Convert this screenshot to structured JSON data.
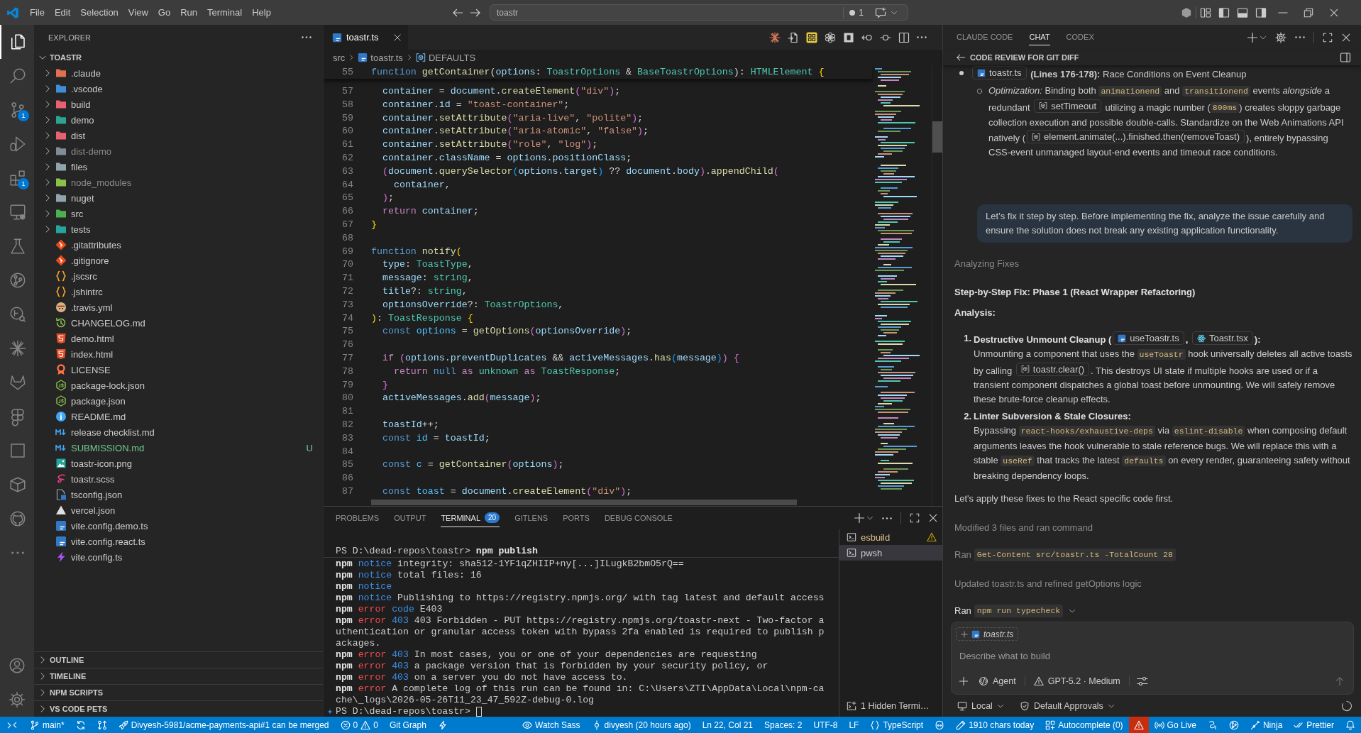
{
  "title_bar": {
    "menu": [
      "File",
      "Edit",
      "Selection",
      "View",
      "Go",
      "Run",
      "Terminal",
      "Help"
    ],
    "command_center": {
      "text": "toastr",
      "count": "1"
    }
  },
  "activity_bar": {
    "items": [
      {
        "selected": true
      },
      {
        "selected": false
      },
      {
        "selected": false,
        "badge": "1"
      },
      {
        "selected": false
      },
      {
        "selected": false,
        "badge": "1"
      },
      {
        "selected": false
      },
      {
        "selected": false
      },
      {
        "selected": false
      },
      {
        "selected": false
      },
      {
        "selected": false
      },
      {
        "selected": false
      },
      {
        "selected": false
      },
      {
        "selected": false
      },
      {
        "selected": false
      },
      {
        "selected": false
      },
      {
        "selected": false
      }
    ]
  },
  "explorer": {
    "title": "EXPLORER",
    "root": {
      "name": "TOASTR",
      "expanded": true,
      "children": [
        {
          "name": ".claude",
          "kind": "folder",
          "expanded": false,
          "color": "#e07050",
          "ignored": false
        },
        {
          "name": ".vscode",
          "kind": "folder",
          "expanded": false,
          "color": "#3d8fd8",
          "ignored": false
        },
        {
          "name": "build",
          "kind": "folder",
          "expanded": false,
          "color": "#e86170",
          "ignored": false
        },
        {
          "name": "demo",
          "kind": "folder",
          "expanded": false,
          "color": "#2aa58f",
          "ignored": false
        },
        {
          "name": "dist",
          "kind": "folder",
          "expanded": false,
          "color": "#e86170",
          "ignored": false
        },
        {
          "name": "dist-demo",
          "kind": "folder",
          "expanded": false,
          "color": "#7f8c99",
          "ignored": true
        },
        {
          "name": "files",
          "kind": "folder",
          "expanded": false,
          "color": "#90a4ae",
          "ignored": false
        },
        {
          "name": "node_modules",
          "kind": "folder",
          "expanded": false,
          "color": "#8bc34a",
          "ignored": true
        },
        {
          "name": "nuget",
          "kind": "folder",
          "expanded": false,
          "color": "#90a4ae",
          "ignored": false
        },
        {
          "name": "src",
          "kind": "folder",
          "expanded": false,
          "color": "#4caf50",
          "ignored": false
        },
        {
          "name": "tests",
          "kind": "folder",
          "expanded": false,
          "color": "#26a69a",
          "ignored": false
        },
        {
          "name": ".gitattributes",
          "kind": "git",
          "ignored": false
        },
        {
          "name": ".gitignore",
          "kind": "git",
          "ignored": false
        },
        {
          "name": ".jscsrc",
          "kind": "rc",
          "ignored": false
        },
        {
          "name": ".jshintrc",
          "kind": "rc",
          "ignored": false
        },
        {
          "name": ".travis.yml",
          "kind": "travis",
          "ignored": false
        },
        {
          "name": "CHANGELOG.md",
          "kind": "changelog",
          "ignored": false
        },
        {
          "name": "demo.html",
          "kind": "html",
          "ignored": false
        },
        {
          "name": "index.html",
          "kind": "html",
          "ignored": false
        },
        {
          "name": "LICENSE",
          "kind": "license",
          "ignored": false
        },
        {
          "name": "package-lock.json",
          "kind": "npm",
          "ignored": false
        },
        {
          "name": "package.json",
          "kind": "npm",
          "ignored": false
        },
        {
          "name": "README.md",
          "kind": "readme",
          "ignored": false
        },
        {
          "name": "release checklist.md",
          "kind": "markdown",
          "ignored": false
        },
        {
          "name": "SUBMISSION.md",
          "kind": "markdown",
          "ignored": false,
          "status": "U"
        },
        {
          "name": "toastr-icon.png",
          "kind": "image",
          "ignored": false
        },
        {
          "name": "toastr.scss",
          "kind": "sass",
          "ignored": false
        },
        {
          "name": "tsconfig.json",
          "kind": "tsconfig",
          "ignored": false
        },
        {
          "name": "vercel.json",
          "kind": "vercel",
          "ignored": false
        },
        {
          "name": "vite.config.demo.ts",
          "kind": "typescript",
          "ignored": false
        },
        {
          "name": "vite.config.react.ts",
          "kind": "typescript",
          "ignored": false
        },
        {
          "name": "vite.config.ts",
          "kind": "vite",
          "ignored": false
        }
      ]
    },
    "sections": [
      {
        "title": "OUTLINE",
        "expanded": false
      },
      {
        "title": "TIMELINE",
        "expanded": false
      },
      {
        "title": "NPM SCRIPTS",
        "expanded": false
      },
      {
        "title": "VS CODE PETS",
        "expanded": false
      }
    ]
  },
  "editor": {
    "tabs": [
      {
        "label": "toastr.ts",
        "selected": true
      }
    ],
    "breadcrumbs": [
      {
        "kind": "folder",
        "text": "src"
      },
      {
        "kind": "file",
        "text": "toastr.ts"
      },
      {
        "kind": "symbol",
        "text": "DEFAULTS"
      }
    ],
    "sticky_line": {
      "number": "55",
      "tokens": [
        {
          "kind": "kw",
          "text": "function "
        },
        {
          "kind": "fn",
          "text": "getContainer"
        },
        {
          "kind": "p",
          "text": "("
        },
        {
          "kind": "var",
          "text": "options"
        },
        {
          "kind": "p",
          "text": ": "
        },
        {
          "kind": "type",
          "text": "ToastrOptions"
        },
        {
          "kind": "p",
          "text": " & "
        },
        {
          "kind": "type",
          "text": "BaseToastrOptions"
        },
        {
          "kind": "p",
          "text": "): "
        },
        {
          "kind": "type",
          "text": "HTMLElement "
        },
        {
          "kind": "b1",
          "text": "{"
        }
      ]
    },
    "lines": [
      {
        "number": "57",
        "tokens": [
          {
            "kind": "var",
            "text": "  container"
          },
          {
            "kind": "p",
            "text": " = "
          },
          {
            "kind": "var",
            "text": "document"
          },
          {
            "kind": "p",
            "text": "."
          },
          {
            "kind": "fn",
            "text": "createElement"
          },
          {
            "kind": "b2",
            "text": "("
          },
          {
            "kind": "str",
            "text": "\"div\""
          },
          {
            "kind": "b2",
            "text": ")"
          },
          {
            "kind": "p",
            "text": ";"
          }
        ]
      },
      {
        "number": "58",
        "tokens": [
          {
            "kind": "var",
            "text": "  container"
          },
          {
            "kind": "p",
            "text": "."
          },
          {
            "kind": "var",
            "text": "id"
          },
          {
            "kind": "p",
            "text": " = "
          },
          {
            "kind": "str",
            "text": "\"toast-container\""
          },
          {
            "kind": "p",
            "text": ";"
          }
        ]
      },
      {
        "number": "59",
        "tokens": [
          {
            "kind": "var",
            "text": "  container"
          },
          {
            "kind": "p",
            "text": "."
          },
          {
            "kind": "fn",
            "text": "setAttribute"
          },
          {
            "kind": "b2",
            "text": "("
          },
          {
            "kind": "str",
            "text": "\"aria-live\""
          },
          {
            "kind": "p",
            "text": ", "
          },
          {
            "kind": "str",
            "text": "\"polite\""
          },
          {
            "kind": "b2",
            "text": ")"
          },
          {
            "kind": "p",
            "text": ";"
          }
        ]
      },
      {
        "number": "60",
        "tokens": [
          {
            "kind": "var",
            "text": "  container"
          },
          {
            "kind": "p",
            "text": "."
          },
          {
            "kind": "fn",
            "text": "setAttribute"
          },
          {
            "kind": "b2",
            "text": "("
          },
          {
            "kind": "str",
            "text": "\"aria-atomic\""
          },
          {
            "kind": "p",
            "text": ", "
          },
          {
            "kind": "str",
            "text": "\"false\""
          },
          {
            "kind": "b2",
            "text": ")"
          },
          {
            "kind": "p",
            "text": ";"
          }
        ]
      },
      {
        "number": "61",
        "tokens": [
          {
            "kind": "var",
            "text": "  container"
          },
          {
            "kind": "p",
            "text": "."
          },
          {
            "kind": "fn",
            "text": "setAttribute"
          },
          {
            "kind": "b2",
            "text": "("
          },
          {
            "kind": "str",
            "text": "\"role\""
          },
          {
            "kind": "p",
            "text": ", "
          },
          {
            "kind": "str",
            "text": "\"log\""
          },
          {
            "kind": "b2",
            "text": ")"
          },
          {
            "kind": "p",
            "text": ";"
          }
        ]
      },
      {
        "number": "62",
        "tokens": [
          {
            "kind": "var",
            "text": "  container"
          },
          {
            "kind": "p",
            "text": "."
          },
          {
            "kind": "var",
            "text": "className"
          },
          {
            "kind": "p",
            "text": " = "
          },
          {
            "kind": "var",
            "text": "options"
          },
          {
            "kind": "p",
            "text": "."
          },
          {
            "kind": "var",
            "text": "positionClass"
          },
          {
            "kind": "p",
            "text": ";"
          }
        ]
      },
      {
        "number": "63",
        "tokens": [
          {
            "kind": "b2",
            "text": "  ("
          },
          {
            "kind": "var",
            "text": "document"
          },
          {
            "kind": "p",
            "text": "."
          },
          {
            "kind": "fn",
            "text": "querySelector"
          },
          {
            "kind": "b3",
            "text": "("
          },
          {
            "kind": "var",
            "text": "options"
          },
          {
            "kind": "p",
            "text": "."
          },
          {
            "kind": "var",
            "text": "target"
          },
          {
            "kind": "b3",
            "text": ")"
          },
          {
            "kind": "p",
            "text": " ?? "
          },
          {
            "kind": "var",
            "text": "document"
          },
          {
            "kind": "p",
            "text": "."
          },
          {
            "kind": "var",
            "text": "body"
          },
          {
            "kind": "b2",
            "text": ")"
          },
          {
            "kind": "p",
            "text": "."
          },
          {
            "kind": "fn",
            "text": "appendChild"
          },
          {
            "kind": "b2",
            "text": "("
          }
        ]
      },
      {
        "number": "64",
        "tokens": [
          {
            "kind": "var",
            "text": "    container"
          },
          {
            "kind": "p",
            "text": ","
          }
        ]
      },
      {
        "number": "65",
        "tokens": [
          {
            "kind": "b2",
            "text": "  )"
          },
          {
            "kind": "p",
            "text": ";"
          }
        ]
      },
      {
        "number": "66",
        "tokens": [
          {
            "kind": "ctl",
            "text": "  return "
          },
          {
            "kind": "var",
            "text": "container"
          },
          {
            "kind": "p",
            "text": ";"
          }
        ]
      },
      {
        "number": "67",
        "tokens": [
          {
            "kind": "b1",
            "text": "}"
          }
        ]
      },
      {
        "number": "68"
      },
      {
        "number": "69",
        "tokens": [
          {
            "kind": "kw",
            "text": "function "
          },
          {
            "kind": "fn",
            "text": "notify"
          },
          {
            "kind": "b1",
            "text": "("
          }
        ]
      },
      {
        "number": "70",
        "tokens": [
          {
            "kind": "var",
            "text": "  type"
          },
          {
            "kind": "p",
            "text": ": "
          },
          {
            "kind": "type",
            "text": "ToastType"
          },
          {
            "kind": "p",
            "text": ","
          }
        ]
      },
      {
        "number": "71",
        "tokens": [
          {
            "kind": "var",
            "text": "  message"
          },
          {
            "kind": "p",
            "text": ": "
          },
          {
            "kind": "type",
            "text": "string"
          },
          {
            "kind": "p",
            "text": ","
          }
        ]
      },
      {
        "number": "72",
        "tokens": [
          {
            "kind": "var",
            "text": "  title"
          },
          {
            "kind": "p",
            "text": "?: "
          },
          {
            "kind": "type",
            "text": "string"
          },
          {
            "kind": "p",
            "text": ","
          }
        ]
      },
      {
        "number": "73",
        "tokens": [
          {
            "kind": "var",
            "text": "  optionsOverride"
          },
          {
            "kind": "p",
            "text": "?: "
          },
          {
            "kind": "type",
            "text": "ToastrOptions"
          },
          {
            "kind": "p",
            "text": ","
          }
        ]
      },
      {
        "number": "74",
        "tokens": [
          {
            "kind": "b1",
            "text": ")"
          },
          {
            "kind": "p",
            "text": ": "
          },
          {
            "kind": "type",
            "text": "ToastResponse "
          },
          {
            "kind": "b1",
            "text": "{"
          }
        ]
      },
      {
        "number": "75",
        "tokens": [
          {
            "kind": "kw",
            "text": "  const "
          },
          {
            "kind": "cst",
            "text": "options"
          },
          {
            "kind": "p",
            "text": " = "
          },
          {
            "kind": "fn",
            "text": "getOptions"
          },
          {
            "kind": "b2",
            "text": "("
          },
          {
            "kind": "var",
            "text": "optionsOverride"
          },
          {
            "kind": "b2",
            "text": ")"
          },
          {
            "kind": "p",
            "text": ";"
          }
        ]
      },
      {
        "number": "76"
      },
      {
        "number": "77",
        "tokens": [
          {
            "kind": "ctl",
            "text": "  if "
          },
          {
            "kind": "b2",
            "text": "("
          },
          {
            "kind": "var",
            "text": "options"
          },
          {
            "kind": "p",
            "text": "."
          },
          {
            "kind": "var",
            "text": "preventDuplicates"
          },
          {
            "kind": "p",
            "text": " && "
          },
          {
            "kind": "var",
            "text": "activeMessages"
          },
          {
            "kind": "p",
            "text": "."
          },
          {
            "kind": "fn",
            "text": "has"
          },
          {
            "kind": "b3",
            "text": "("
          },
          {
            "kind": "var",
            "text": "message"
          },
          {
            "kind": "b3",
            "text": ")"
          },
          {
            "kind": "b2",
            "text": ") {"
          }
        ]
      },
      {
        "number": "78",
        "tokens": [
          {
            "kind": "ctl",
            "text": "    return "
          },
          {
            "kind": "kw",
            "text": "null "
          },
          {
            "kind": "ctl",
            "text": "as "
          },
          {
            "kind": "type",
            "text": "unknown "
          },
          {
            "kind": "ctl",
            "text": "as "
          },
          {
            "kind": "type",
            "text": "ToastResponse"
          },
          {
            "kind": "p",
            "text": ";"
          }
        ]
      },
      {
        "number": "79",
        "tokens": [
          {
            "kind": "b2",
            "text": "  }"
          }
        ]
      },
      {
        "number": "80",
        "tokens": [
          {
            "kind": "var",
            "text": "  activeMessages"
          },
          {
            "kind": "p",
            "text": "."
          },
          {
            "kind": "fn",
            "text": "add"
          },
          {
            "kind": "b2",
            "text": "("
          },
          {
            "kind": "var",
            "text": "message"
          },
          {
            "kind": "b2",
            "text": ")"
          },
          {
            "kind": "p",
            "text": ";"
          }
        ]
      },
      {
        "number": "81"
      },
      {
        "number": "82",
        "tokens": [
          {
            "kind": "var",
            "text": "  toastId"
          },
          {
            "kind": "p",
            "text": "++;"
          }
        ]
      },
      {
        "number": "83",
        "tokens": [
          {
            "kind": "kw",
            "text": "  const "
          },
          {
            "kind": "cst",
            "text": "id"
          },
          {
            "kind": "p",
            "text": " = "
          },
          {
            "kind": "var",
            "text": "toastId"
          },
          {
            "kind": "p",
            "text": ";"
          }
        ]
      },
      {
        "number": "84"
      },
      {
        "number": "85",
        "tokens": [
          {
            "kind": "kw",
            "text": "  const "
          },
          {
            "kind": "cst",
            "text": "c"
          },
          {
            "kind": "p",
            "text": " = "
          },
          {
            "kind": "fn",
            "text": "getContainer"
          },
          {
            "kind": "b2",
            "text": "("
          },
          {
            "kind": "var",
            "text": "options"
          },
          {
            "kind": "b2",
            "text": ")"
          },
          {
            "kind": "p",
            "text": ";"
          }
        ]
      },
      {
        "number": "86"
      },
      {
        "number": "87",
        "tokens": [
          {
            "kind": "kw",
            "text": "  const "
          },
          {
            "kind": "cst",
            "text": "toast"
          },
          {
            "kind": "p",
            "text": " = "
          },
          {
            "kind": "var",
            "text": "document"
          },
          {
            "kind": "p",
            "text": "."
          },
          {
            "kind": "fn",
            "text": "createElement"
          },
          {
            "kind": "b2",
            "text": "("
          },
          {
            "kind": "str",
            "text": "\"div\""
          },
          {
            "kind": "b2",
            "text": ")"
          },
          {
            "kind": "p",
            "text": ";"
          }
        ]
      }
    ]
  },
  "panel": {
    "tabs": [
      {
        "label": "PROBLEMS",
        "selected": false
      },
      {
        "label": "OUTPUT",
        "selected": false
      },
      {
        "label": "TERMINAL",
        "selected": true,
        "badge": "20"
      },
      {
        "label": "GITLENS",
        "selected": false
      },
      {
        "label": "PORTS",
        "selected": false
      },
      {
        "label": "DEBUG CONSOLE",
        "selected": false
      }
    ],
    "terminal": {
      "sticky_line": [
        {
          "kind": "plain",
          "text": "PS D:\\dead-repos\\toastr> "
        },
        {
          "kind": "cmd",
          "text": "npm publish"
        }
      ],
      "lines": [
        [
          {
            "kind": "npm",
            "text": "npm"
          },
          {
            "kind": "notice",
            "text": " notice"
          },
          {
            "kind": "plain",
            "text": " integrity: sha512-1YF1qZHIIP+ny[...]ILugkB2bmO5rQ=="
          }
        ],
        [
          {
            "kind": "npm",
            "text": "npm"
          },
          {
            "kind": "notice",
            "text": " notice"
          },
          {
            "kind": "plain",
            "text": " total files: 16"
          }
        ],
        [
          {
            "kind": "npm",
            "text": "npm"
          },
          {
            "kind": "notice",
            "text": " notice"
          }
        ],
        [
          {
            "kind": "npm",
            "text": "npm"
          },
          {
            "kind": "notice",
            "text": " notice"
          },
          {
            "kind": "plain",
            "text": " Publishing to https://registry.npmjs.org/ with tag latest and default access"
          }
        ],
        [
          {
            "kind": "npm",
            "text": "npm"
          },
          {
            "kind": "error",
            "text": " error"
          },
          {
            "kind": "num",
            "text": " code"
          },
          {
            "kind": "plain",
            "text": " E403"
          }
        ],
        [
          {
            "kind": "npm",
            "text": "npm"
          },
          {
            "kind": "error",
            "text": " error"
          },
          {
            "kind": "num",
            "text": " 403"
          },
          {
            "kind": "plain",
            "text": " 403 Forbidden - PUT https://registry.npmjs.org/toastr-next - Two-factor a"
          }
        ],
        [
          {
            "kind": "plain",
            "text": "uthentication or granular access token with bypass 2fa enabled is required to publish p"
          }
        ],
        [
          {
            "kind": "plain",
            "text": "ackages."
          }
        ],
        [
          {
            "kind": "npm",
            "text": "npm"
          },
          {
            "kind": "error",
            "text": " error"
          },
          {
            "kind": "num",
            "text": " 403"
          },
          {
            "kind": "plain",
            "text": " In most cases, you or one of your dependencies are requesting"
          }
        ],
        [
          {
            "kind": "npm",
            "text": "npm"
          },
          {
            "kind": "error",
            "text": " error"
          },
          {
            "kind": "num",
            "text": " 403"
          },
          {
            "kind": "plain",
            "text": " a package version that is forbidden by your security policy, or"
          }
        ],
        [
          {
            "kind": "npm",
            "text": "npm"
          },
          {
            "kind": "error",
            "text": " error"
          },
          {
            "kind": "num",
            "text": " 403"
          },
          {
            "kind": "plain",
            "text": " on a server you do not have access to."
          }
        ],
        [
          {
            "kind": "npm",
            "text": "npm"
          },
          {
            "kind": "error",
            "text": " error"
          },
          {
            "kind": "plain",
            "text": " A complete log of this run can be found in: C:\\Users\\ZTI\\AppData\\Local\\npm-ca"
          }
        ],
        [
          {
            "kind": "plain",
            "text": "che\\_logs\\2026-05-26T11_23_47_592Z-debug-0.log"
          }
        ]
      ],
      "prompt": {
        "text": "PS D:\\dead-repos\\toastr>",
        "cursor": true
      }
    },
    "terminals": [
      {
        "name": "esbuild",
        "selected": false,
        "warning": true
      },
      {
        "name": "pwsh",
        "selected": true,
        "warning": false
      }
    ],
    "hidden_terminals": "1 Hidden Termi…"
  },
  "chat": {
    "tabs": [
      {
        "label": "CLAUDE CODE",
        "selected": false
      },
      {
        "label": "CHAT",
        "selected": true
      },
      {
        "label": "CODEX",
        "selected": false
      }
    ],
    "title": "CODE REVIEW FOR GIT DIFF",
    "blocks": [
      {
        "kind": "bullet",
        "segments": [
          {
            "kind": "file",
            "text": "toastr.ts"
          },
          {
            "kind": "text",
            "text": " **(Lines 176-178):** Race Conditions on Event Cleanup"
          }
        ],
        "children": [
          {
            "segments": [
              {
                "kind": "text",
                "text": "*Optimization:* Binding both "
              },
              {
                "kind": "code",
                "text": "animationend"
              },
              {
                "kind": "text",
                "text": " and "
              },
              {
                "kind": "code",
                "text": "transitionend"
              },
              {
                "kind": "text",
                "text": " events *alongside* a redundant "
              },
              {
                "kind": "symbol",
                "text": "setTimeout"
              },
              {
                "kind": "text",
                "text": " utilizing a magic number ("
              },
              {
                "kind": "code",
                "text": "800ms"
              },
              {
                "kind": "text",
                "text": ") creates sloppy garbage collection execution and possible double-calls. Standardize on the Web Animations API natively ("
              },
              {
                "kind": "symbol",
                "text": "element.animate(...).finished.then(removeToast)"
              },
              {
                "kind": "text",
                "text": "), entirely bypassing CSS-event unmanaged layout-end events and timeout race conditions."
              }
            ]
          }
        ]
      },
      {
        "kind": "user",
        "segments": [
          {
            "kind": "text",
            "text": "Let’s fix it step by step. Before implementing the fix, analyze the issue carefully and ensure the solution does not break any existing application functionality."
          }
        ]
      },
      {
        "kind": "status",
        "segments": [
          {
            "kind": "text",
            "text": "Analyzing Fixes"
          }
        ]
      },
      {
        "kind": "heading",
        "segments": [
          {
            "kind": "text",
            "text": "Step-by-Step Fix: Phase 1 (React Wrapper Refactoring)"
          }
        ]
      },
      {
        "kind": "heading",
        "segments": [
          {
            "kind": "text",
            "text": "Analysis:"
          }
        ]
      },
      {
        "kind": "numbered",
        "number": "1.",
        "title": [
          {
            "kind": "text",
            "text": "Destructive Unmount Cleanup ("
          },
          {
            "kind": "file",
            "text": "useToastr.ts"
          },
          {
            "kind": "text",
            "text": ", "
          },
          {
            "kind": "tsx",
            "text": "Toastr.tsx"
          },
          {
            "kind": "text",
            "text": "):"
          }
        ],
        "segments": [
          {
            "kind": "text",
            "text": "Unmounting a component that uses the "
          },
          {
            "kind": "code",
            "text": "useToastr"
          },
          {
            "kind": "text",
            "text": " hook universally deletes all active toasts by calling "
          },
          {
            "kind": "symbol",
            "text": "toastr.clear()"
          },
          {
            "kind": "text",
            "text": ". This destroys UI state if multiple hooks are used or if a transient component dispatches a global toast before unmounting. We will safely remove these brute-force cleanup effects."
          }
        ]
      },
      {
        "kind": "numbered",
        "number": "2.",
        "title": [
          {
            "kind": "text",
            "text": "Linter Subversion & Stale Closures:"
          }
        ],
        "segments": [
          {
            "kind": "text",
            "text": "Bypassing "
          },
          {
            "kind": "code",
            "text": "react-hooks/exhaustive-deps"
          },
          {
            "kind": "text",
            "text": " via "
          },
          {
            "kind": "code",
            "text": "eslint-disable"
          },
          {
            "kind": "text",
            "text": " when composing default arguments leaves the hook vulnerable to stale reference bugs. We will replace this with a stable "
          },
          {
            "kind": "code",
            "text": "useRef"
          },
          {
            "kind": "text",
            "text": " that tracks the latest "
          },
          {
            "kind": "code",
            "text": "defaults"
          },
          {
            "kind": "text",
            "text": " on every render, guaranteeing safety without breaking dependency loops."
          }
        ]
      },
      {
        "kind": "paragraph",
        "segments": [
          {
            "kind": "text",
            "text": "Let's apply these fixes to the React specific code first."
          }
        ]
      },
      {
        "kind": "status",
        "segments": [
          {
            "kind": "text",
            "text": "Modified 3 files and ran command"
          }
        ]
      },
      {
        "kind": "command",
        "label": "Ran",
        "command": "Get-Content src/toastr.ts -TotalCount 28",
        "active": false
      },
      {
        "kind": "status",
        "segments": [
          {
            "kind": "text",
            "text": "Updated toastr.ts and refined getOptions logic"
          }
        ]
      },
      {
        "kind": "command",
        "label": "Ran",
        "command": "npm run typecheck",
        "active": true
      }
    ],
    "composer": {
      "context": "toastr.ts",
      "placeholder": "Describe what to build",
      "mode": "Agent",
      "model": "GPT-5.2 · Medium"
    },
    "footer": {
      "location": "Local",
      "approvals": "Default Approvals"
    }
  },
  "status_bar": {
    "left": [
      {
        "kind": "remote"
      },
      {
        "kind": "branch",
        "text": "main*"
      },
      {
        "kind": "sync"
      },
      {
        "kind": "compare"
      },
      {
        "kind": "pullrequest",
        "text": "Divyesh-5981/acme-payments-api#1 can be merged"
      },
      {
        "kind": "problems",
        "errors": "0",
        "warnings": "0"
      },
      {
        "kind": "gitgraph",
        "text": "Git Graph"
      },
      {
        "kind": "action"
      }
    ],
    "right": [
      {
        "kind": "watch",
        "text": "Watch Sass"
      },
      {
        "kind": "blame",
        "text": "divyesh (20 hours ago)"
      },
      {
        "kind": "cursor",
        "text": "Ln 22, Col 21"
      },
      {
        "kind": "indent",
        "text": "Spaces: 2"
      },
      {
        "kind": "encoding",
        "text": "UTF-8"
      },
      {
        "kind": "eol",
        "text": "LF"
      },
      {
        "kind": "language",
        "text": "TypeScript"
      },
      {
        "kind": "copilot"
      },
      {
        "kind": "stats",
        "text": "1910 chars today"
      },
      {
        "kind": "autocomplete",
        "text": "Autocomplete (0)"
      },
      {
        "kind": "alert"
      },
      {
        "kind": "live",
        "text": "Go Live"
      },
      {
        "kind": "extension"
      },
      {
        "kind": "launchpad"
      },
      {
        "kind": "ninja",
        "text": "Ninja"
      },
      {
        "kind": "prettier",
        "text": "Prettier"
      },
      {
        "kind": "notifications"
      }
    ]
  }
}
